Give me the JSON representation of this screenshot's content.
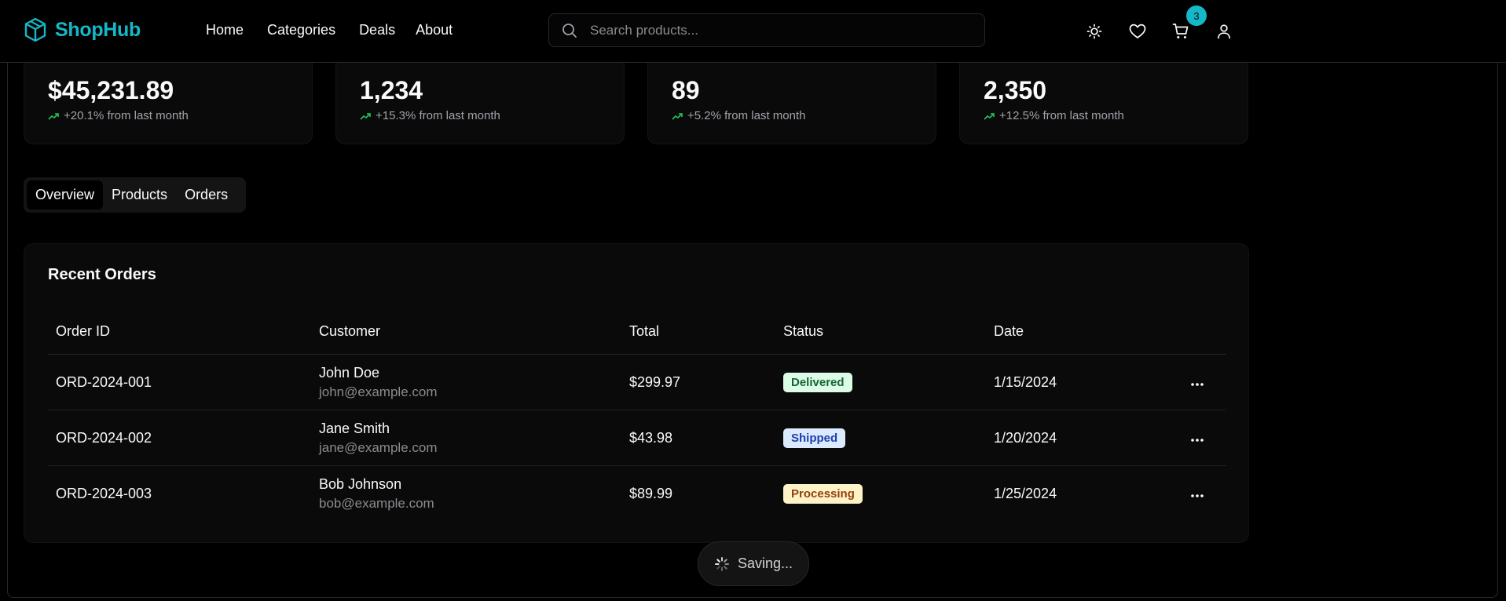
{
  "brand": {
    "name": "ShopHub",
    "accent": "#14b8c8"
  },
  "nav": [
    "Home",
    "Categories",
    "Deals",
    "About"
  ],
  "search": {
    "placeholder": "Search products..."
  },
  "header_icons": [
    "sun-icon",
    "heart-icon",
    "cart-icon",
    "user-icon"
  ],
  "cart_count": "3",
  "stats": [
    {
      "value": "$45,231.89",
      "delta": "+20.1% from last month"
    },
    {
      "value": "1,234",
      "delta": "+15.3% from last month"
    },
    {
      "value": "89",
      "delta": "+5.2% from last month"
    },
    {
      "value": "2,350",
      "delta": "+12.5% from last month"
    }
  ],
  "tabs": [
    "Overview",
    "Products",
    "Orders"
  ],
  "active_tab": "Overview",
  "orders": {
    "title": "Recent Orders",
    "columns": [
      "Order ID",
      "Customer",
      "Total",
      "Status",
      "Date"
    ],
    "rows": [
      {
        "id": "ORD-2024-001",
        "name": "John Doe",
        "email": "john@example.com",
        "total": "$299.97",
        "status": "Delivered",
        "date": "1/15/2024"
      },
      {
        "id": "ORD-2024-002",
        "name": "Jane Smith",
        "email": "jane@example.com",
        "total": "$43.98",
        "status": "Shipped",
        "date": "1/20/2024"
      },
      {
        "id": "ORD-2024-003",
        "name": "Bob Johnson",
        "email": "bob@example.com",
        "total": "$89.99",
        "status": "Processing",
        "date": "1/25/2024"
      }
    ]
  },
  "status_colors": {
    "Delivered": "#166534",
    "Shipped": "#1e40af",
    "Processing": "#92400e"
  },
  "toast": {
    "label": "Saving..."
  }
}
